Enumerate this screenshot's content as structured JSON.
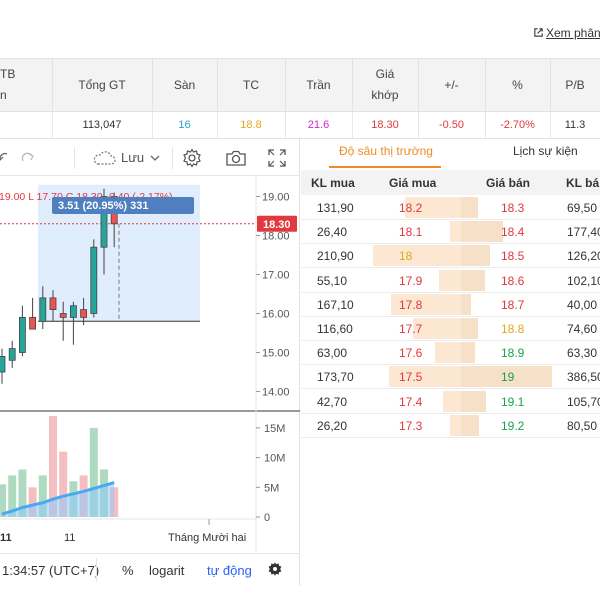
{
  "top_link": {
    "label": "Xem phân"
  },
  "quote": {
    "headers": [
      {
        "key": "tb",
        "label": "TB\nn"
      },
      {
        "key": "total",
        "label": "Tổng GT"
      },
      {
        "key": "floor",
        "label": "Sàn"
      },
      {
        "key": "ref",
        "label": "TC"
      },
      {
        "key": "ceil",
        "label": "Trần"
      },
      {
        "key": "match",
        "label": "Giá\nkhớp"
      },
      {
        "key": "chg",
        "label": "+/-"
      },
      {
        "key": "pct",
        "label": "%"
      },
      {
        "key": "pb",
        "label": "P/B"
      }
    ],
    "row": {
      "tb": "",
      "total": "113,047",
      "floor": "16",
      "ref": "18.8",
      "ceil": "21.6",
      "match": "18.30",
      "chg": "-0.50",
      "pct": "-2.70%",
      "pb": "11.3"
    }
  },
  "toolbar": {
    "save_label": "Lưu"
  },
  "chart_data": {
    "type": "candlestick",
    "ohlc_label": "19.00  L 17.70  C 18.30  -0.40 (-2.17%)",
    "measure_label": "3.51 (20.95%) 331",
    "last_price_label": "18.30",
    "price_axis": {
      "ticks": [
        "19.00",
        "18.00",
        "17.00",
        "16.00",
        "15.00",
        "14.00"
      ],
      "range": [
        13.5,
        19.5
      ]
    },
    "volume_axis": {
      "ticks": [
        "15M",
        "10M",
        "5M",
        "0"
      ],
      "range": [
        0,
        17
      ]
    },
    "x_labels": [
      "11",
      "11",
      "Tháng Mười hai"
    ],
    "candles": [
      {
        "o": 14.5,
        "h": 15.1,
        "l": 14.2,
        "c": 14.9
      },
      {
        "o": 14.8,
        "h": 15.3,
        "l": 14.6,
        "c": 15.1
      },
      {
        "o": 15.0,
        "h": 16.2,
        "l": 14.9,
        "c": 15.9
      },
      {
        "o": 15.9,
        "h": 16.4,
        "l": 15.6,
        "c": 15.6
      },
      {
        "o": 15.8,
        "h": 16.7,
        "l": 15.6,
        "c": 16.4
      },
      {
        "o": 16.4,
        "h": 16.6,
        "l": 15.8,
        "c": 16.1
      },
      {
        "o": 16.0,
        "h": 16.3,
        "l": 15.3,
        "c": 15.9
      },
      {
        "o": 15.9,
        "h": 16.3,
        "l": 15.2,
        "c": 16.2
      },
      {
        "o": 16.1,
        "h": 16.4,
        "l": 15.7,
        "c": 15.9
      },
      {
        "o": 16.0,
        "h": 17.9,
        "l": 15.9,
        "c": 17.7
      },
      {
        "o": 17.7,
        "h": 19.2,
        "l": 17.0,
        "c": 19.0
      },
      {
        "o": 19.0,
        "h": 19.1,
        "l": 17.7,
        "c": 18.3
      }
    ],
    "volumes": [
      5.5,
      7,
      8,
      5,
      7,
      17,
      11,
      6,
      7,
      15,
      8,
      5
    ],
    "volume_ma": [
      0.5,
      1.0,
      1.6,
      2.0,
      2.4,
      3.0,
      3.5,
      3.9,
      4.3,
      4.8,
      5.3,
      5.8
    ]
  },
  "bottom_bar": {
    "time": "1:34:57 (UTC+7)",
    "percent": "%",
    "log": "logarit",
    "auto": "tự động"
  },
  "orderbook": {
    "tabs": {
      "depth": "Độ sâu thị trường",
      "history": "Lịch sự kiện"
    },
    "headers": {
      "bid_vol": "KL mua",
      "bid_price": "Giá mua",
      "ask_price": "Giá bán",
      "ask_vol": "KL bá"
    },
    "rows": [
      {
        "bid_vol": "131,90",
        "bid_price": "18.2",
        "ask_price": "18.3",
        "ask_vol": "69,50",
        "bid_color": "red",
        "ask_color": "red",
        "bid_share": 0.35,
        "ask_share": 0.12
      },
      {
        "bid_vol": "26,40",
        "bid_price": "18.1",
        "ask_price": "18.4",
        "ask_vol": "177,40",
        "bid_color": "red",
        "ask_color": "red",
        "bid_share": 0.07,
        "ask_share": 0.3
      },
      {
        "bid_vol": "210,90",
        "bid_price": "18",
        "ask_price": "18.5",
        "ask_vol": "126,20",
        "bid_color": "yellow",
        "ask_color": "red",
        "bid_share": 0.55,
        "ask_share": 0.21
      },
      {
        "bid_vol": "55,10",
        "bid_price": "17.9",
        "ask_price": "18.6",
        "ask_vol": "102,10",
        "bid_color": "red",
        "ask_color": "red",
        "bid_share": 0.14,
        "ask_share": 0.17
      },
      {
        "bid_vol": "167,10",
        "bid_price": "17.8",
        "ask_price": "18.7",
        "ask_vol": "40,00",
        "bid_color": "red",
        "ask_color": "red",
        "bid_share": 0.44,
        "ask_share": 0.07
      },
      {
        "bid_vol": "116,60",
        "bid_price": "17.7",
        "ask_price": "18.8",
        "ask_vol": "74,60",
        "bid_color": "red",
        "ask_color": "yellow",
        "bid_share": 0.3,
        "ask_share": 0.12
      },
      {
        "bid_vol": "63,00",
        "bid_price": "17.6",
        "ask_price": "18.9",
        "ask_vol": "63,30",
        "bid_color": "red",
        "ask_color": "green",
        "bid_share": 0.16,
        "ask_share": 0.1
      },
      {
        "bid_vol": "173,70",
        "bid_price": "17.5",
        "ask_price": "19",
        "ask_vol": "386,50",
        "bid_color": "red",
        "ask_color": "green",
        "bid_share": 0.45,
        "ask_share": 0.65
      },
      {
        "bid_vol": "42,70",
        "bid_price": "17.4",
        "ask_price": "19.1",
        "ask_vol": "105,70",
        "bid_color": "red",
        "ask_color": "green",
        "bid_share": 0.11,
        "ask_share": 0.18
      },
      {
        "bid_vol": "26,20",
        "bid_price": "17.3",
        "ask_price": "19.2",
        "ask_vol": "80,50",
        "bid_color": "red",
        "ask_color": "green",
        "bid_share": 0.07,
        "ask_share": 0.13
      }
    ]
  }
}
